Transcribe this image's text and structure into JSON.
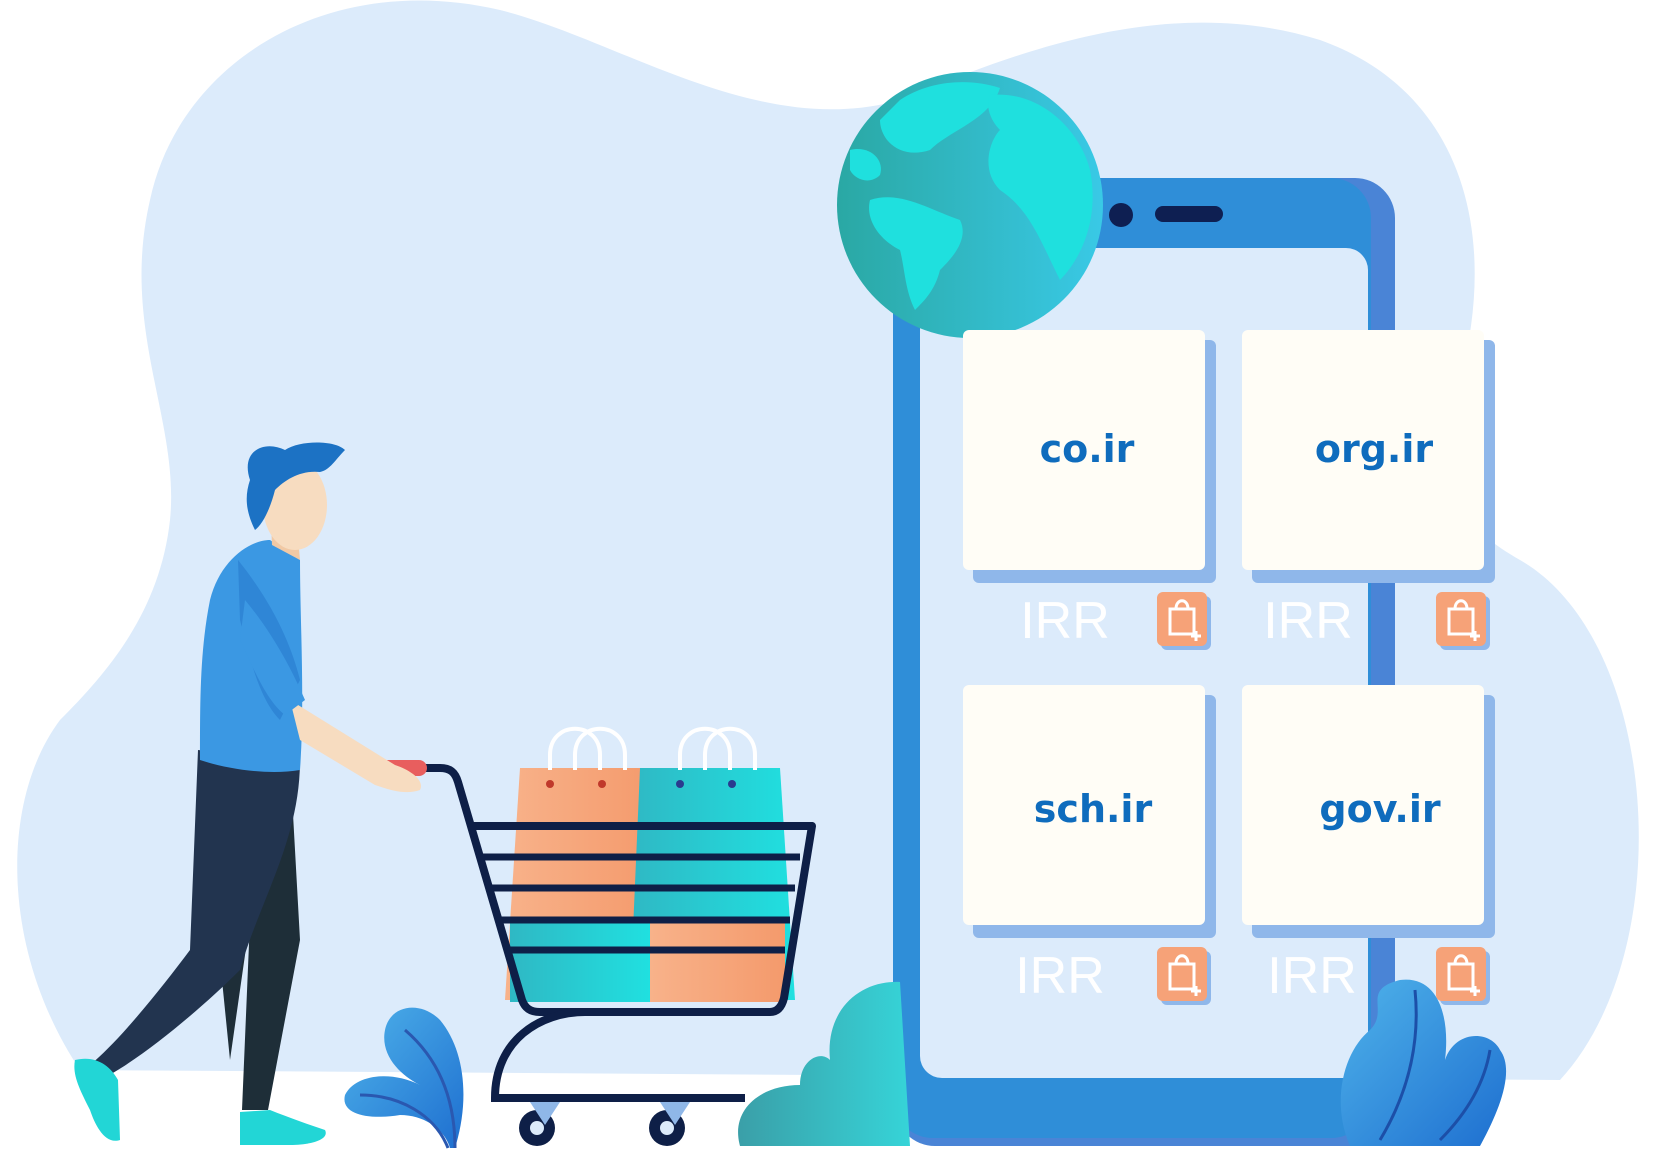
{
  "domains": [
    {
      "name": "co.ir",
      "currency": "IRR"
    },
    {
      "name": "org.ir",
      "currency": "IRR"
    },
    {
      "name": "sch.ir",
      "currency": "IRR"
    },
    {
      "name": "gov.ir",
      "currency": "IRR"
    }
  ],
  "icons": {
    "globe": "globe-icon",
    "cart": "shopping-cart-icon",
    "add_to_cart": "shopping-bag-plus-icon"
  },
  "colors": {
    "background_blob": "#dcebfb",
    "phone_frame": "#2f8ed8",
    "phone_screen": "#dcebfb",
    "card": "#fffdf6",
    "domain_text": "#0f6cbd",
    "orange": "#f6a278",
    "teal": "#23d3d9"
  }
}
